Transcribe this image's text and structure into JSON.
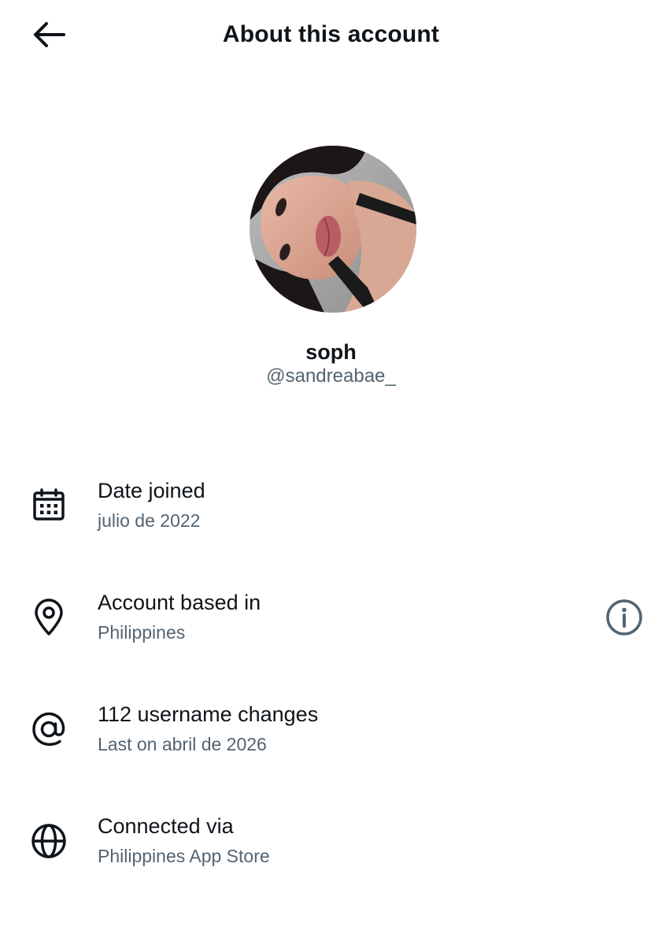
{
  "header": {
    "title": "About this account",
    "back_icon": "arrow-left-icon"
  },
  "profile": {
    "display_name": "soph",
    "handle": "@sandreabae_",
    "avatar": "profile-photo"
  },
  "rows": [
    {
      "icon": "calendar-icon",
      "title": "Date joined",
      "subtitle": "julio de 2022"
    },
    {
      "icon": "location-pin-icon",
      "title": "Account based in",
      "subtitle": "Philippines",
      "action_icon": "info-icon"
    },
    {
      "icon": "at-sign-icon",
      "title": "112 username changes",
      "subtitle": "Last on abril de 2026"
    },
    {
      "icon": "globe-icon",
      "title": "Connected via",
      "subtitle": "Philippines App Store"
    }
  ],
  "colors": {
    "text_primary": "#0f1419",
    "text_secondary": "#536471",
    "background": "#ffffff"
  }
}
